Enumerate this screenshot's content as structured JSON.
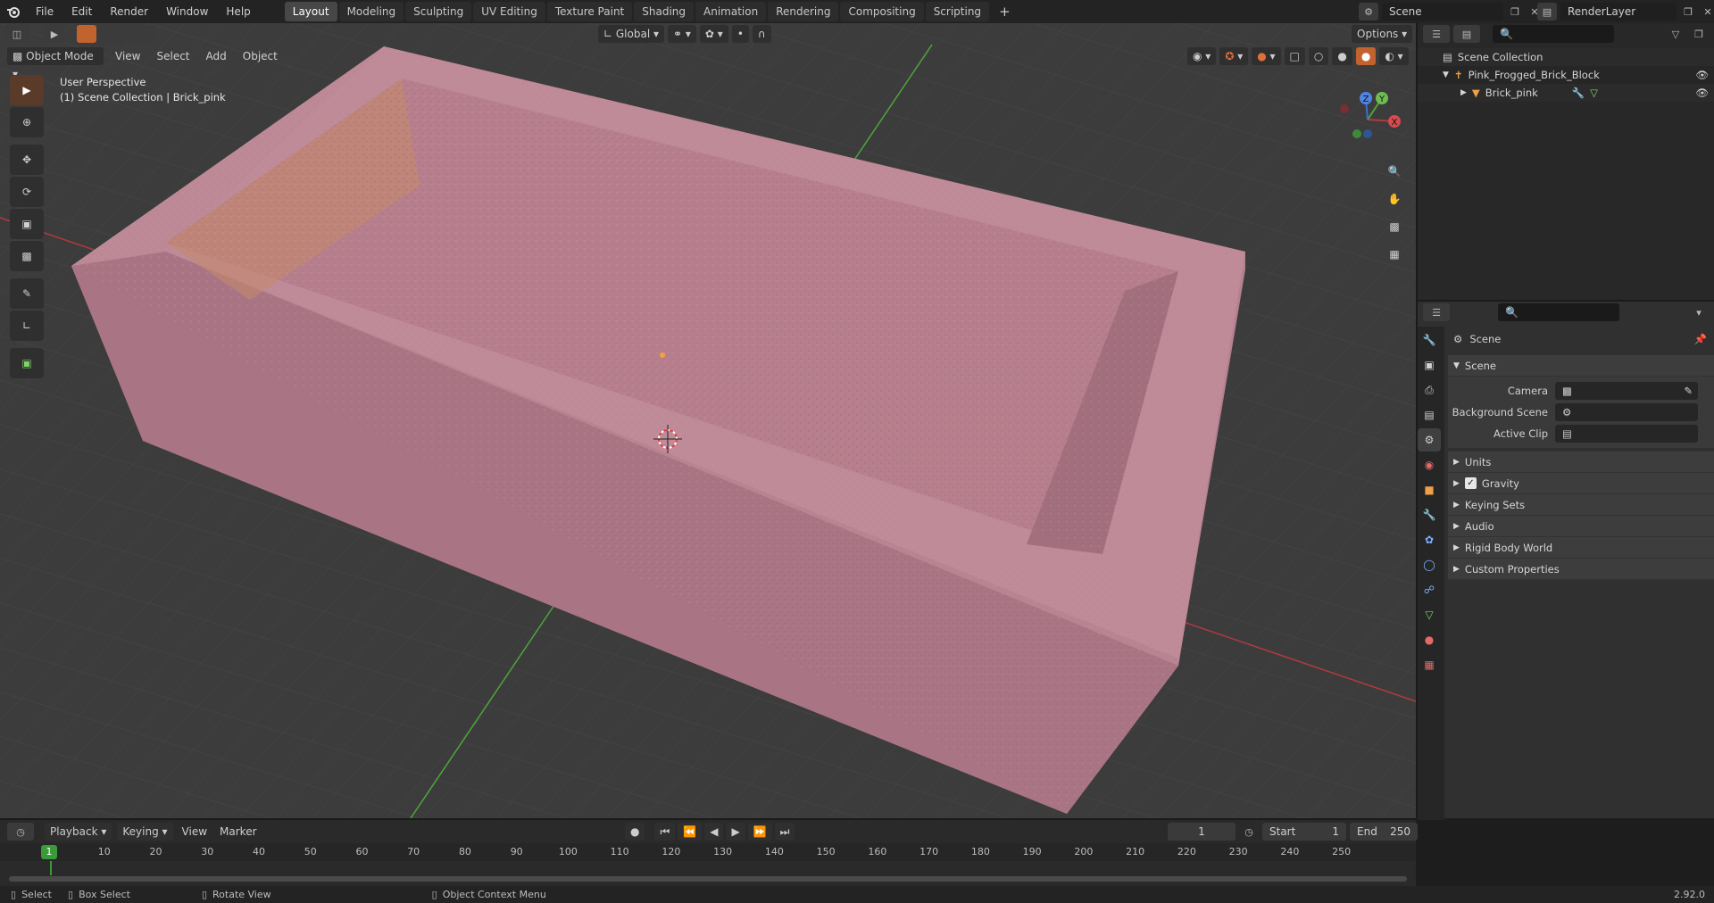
{
  "app": {
    "menu": [
      "File",
      "Edit",
      "Render",
      "Window",
      "Help"
    ],
    "workspaces": [
      "Layout",
      "Modeling",
      "Sculpting",
      "UV Editing",
      "Texture Paint",
      "Shading",
      "Animation",
      "Rendering",
      "Compositing",
      "Scripting"
    ],
    "active_workspace": "Layout",
    "add_workspace": "+",
    "scene_name": "Scene",
    "render_layer": "RenderLayer"
  },
  "viewport": {
    "transform_orientation": "Global",
    "options_label": "Options",
    "mode": "Object Mode",
    "header_menu": [
      "View",
      "Select",
      "Add",
      "Object"
    ],
    "view_name": "User Perspective",
    "active_info": "(1) Scene Collection | Brick_pink",
    "gizmo_axes": {
      "x": "X",
      "y": "Y",
      "z": "Z"
    },
    "colors": {
      "background": "#3c3c3c",
      "object": "#c48c98",
      "x_axis": "#b33a3f",
      "y_axis": "#4ea53c",
      "active_tool": "#e0703a"
    }
  },
  "outliner": {
    "root": "Scene Collection",
    "items": [
      {
        "name": "Pink_Frogged_Brick_Block",
        "type": "empty"
      },
      {
        "name": "Brick_pink",
        "type": "mesh"
      }
    ]
  },
  "properties": {
    "context": "Scene",
    "panel_title": "Scene",
    "fields": [
      {
        "label": "Camera",
        "value": ""
      },
      {
        "label": "Background Scene",
        "value": ""
      },
      {
        "label": "Active Clip",
        "value": ""
      }
    ],
    "panels": [
      {
        "label": "Units",
        "checkbox": false
      },
      {
        "label": "Gravity",
        "checkbox": true
      },
      {
        "label": "Keying Sets",
        "checkbox": false
      },
      {
        "label": "Audio",
        "checkbox": false
      },
      {
        "label": "Rigid Body World",
        "checkbox": false
      },
      {
        "label": "Custom Properties",
        "checkbox": false
      }
    ]
  },
  "timeline": {
    "menus": [
      "Playback",
      "Keying",
      "View",
      "Marker"
    ],
    "current_frame": "1",
    "start_label": "Start",
    "start": "1",
    "end_label": "End",
    "end": "250",
    "ticks": [
      "10",
      "20",
      "30",
      "40",
      "50",
      "60",
      "70",
      "80",
      "90",
      "100",
      "110",
      "120",
      "130",
      "140",
      "150",
      "160",
      "170",
      "180",
      "190",
      "200",
      "210",
      "220",
      "230",
      "240",
      "250"
    ],
    "frame_marker": "1"
  },
  "statusbar": {
    "items": [
      "Select",
      "Box Select",
      "Rotate View",
      "Object Context Menu"
    ],
    "version": "2.92.0"
  }
}
